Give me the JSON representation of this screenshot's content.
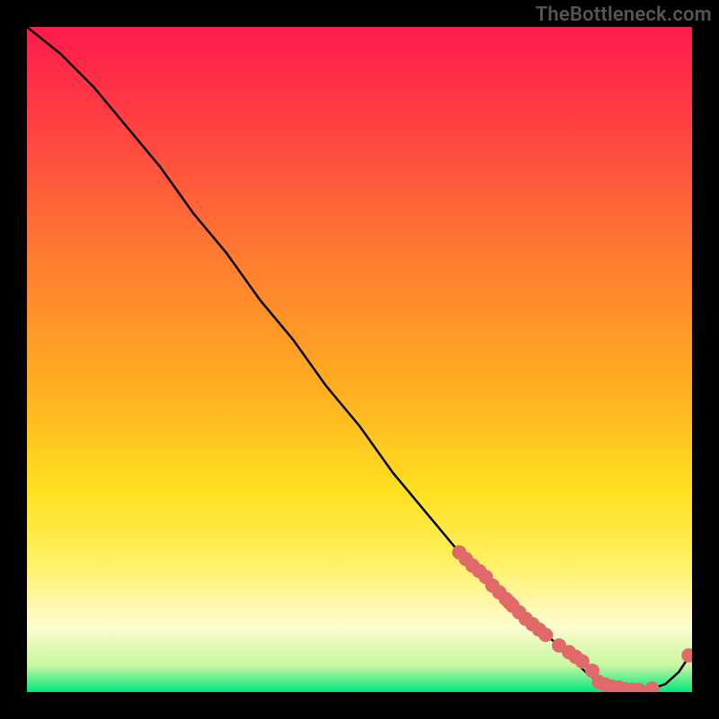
{
  "chart_data": {
    "type": "line",
    "title": "",
    "xlabel": "",
    "ylabel": "",
    "xlim": [
      0,
      100
    ],
    "ylim": [
      0,
      100
    ],
    "grid": false,
    "legend": false,
    "watermark": "TheBottleneck.com",
    "series": [
      {
        "name": "bottleneck-curve",
        "x": [
          0,
          5,
          10,
          15,
          20,
          25,
          30,
          35,
          40,
          45,
          50,
          55,
          60,
          65,
          70,
          75,
          80,
          82,
          84,
          86,
          88,
          90,
          92,
          94,
          96,
          98,
          100
        ],
        "y": [
          100,
          96,
          91,
          85,
          79,
          72,
          66,
          59,
          53,
          46,
          40,
          33,
          27,
          21,
          16,
          11,
          7,
          5,
          3,
          1.5,
          0.8,
          0.4,
          0.3,
          0.5,
          1.2,
          3,
          6
        ]
      }
    ],
    "markers": [
      {
        "name": "highlighted-points",
        "color": "#e06a6a",
        "radius": 8,
        "x": [
          65,
          66,
          67,
          68,
          69,
          70,
          71,
          72,
          72.5,
          73,
          74,
          75,
          76,
          77,
          78,
          80,
          81.5,
          82.5,
          83.5,
          85,
          86,
          87,
          88,
          89,
          90,
          91,
          92,
          94,
          99.5
        ],
        "y": [
          21,
          20,
          19,
          18.2,
          17.3,
          16,
          15,
          14,
          13.5,
          13,
          12,
          11,
          10.2,
          9.4,
          8.6,
          7,
          6,
          5.3,
          4.6,
          3.2,
          1.5,
          1.1,
          0.8,
          0.7,
          0.4,
          0.35,
          0.3,
          0.5,
          5.5
        ]
      }
    ]
  },
  "colors": {
    "line": "#000000",
    "marker": "#e06a6a",
    "watermark": "#555555",
    "bg_black": "#000000"
  }
}
